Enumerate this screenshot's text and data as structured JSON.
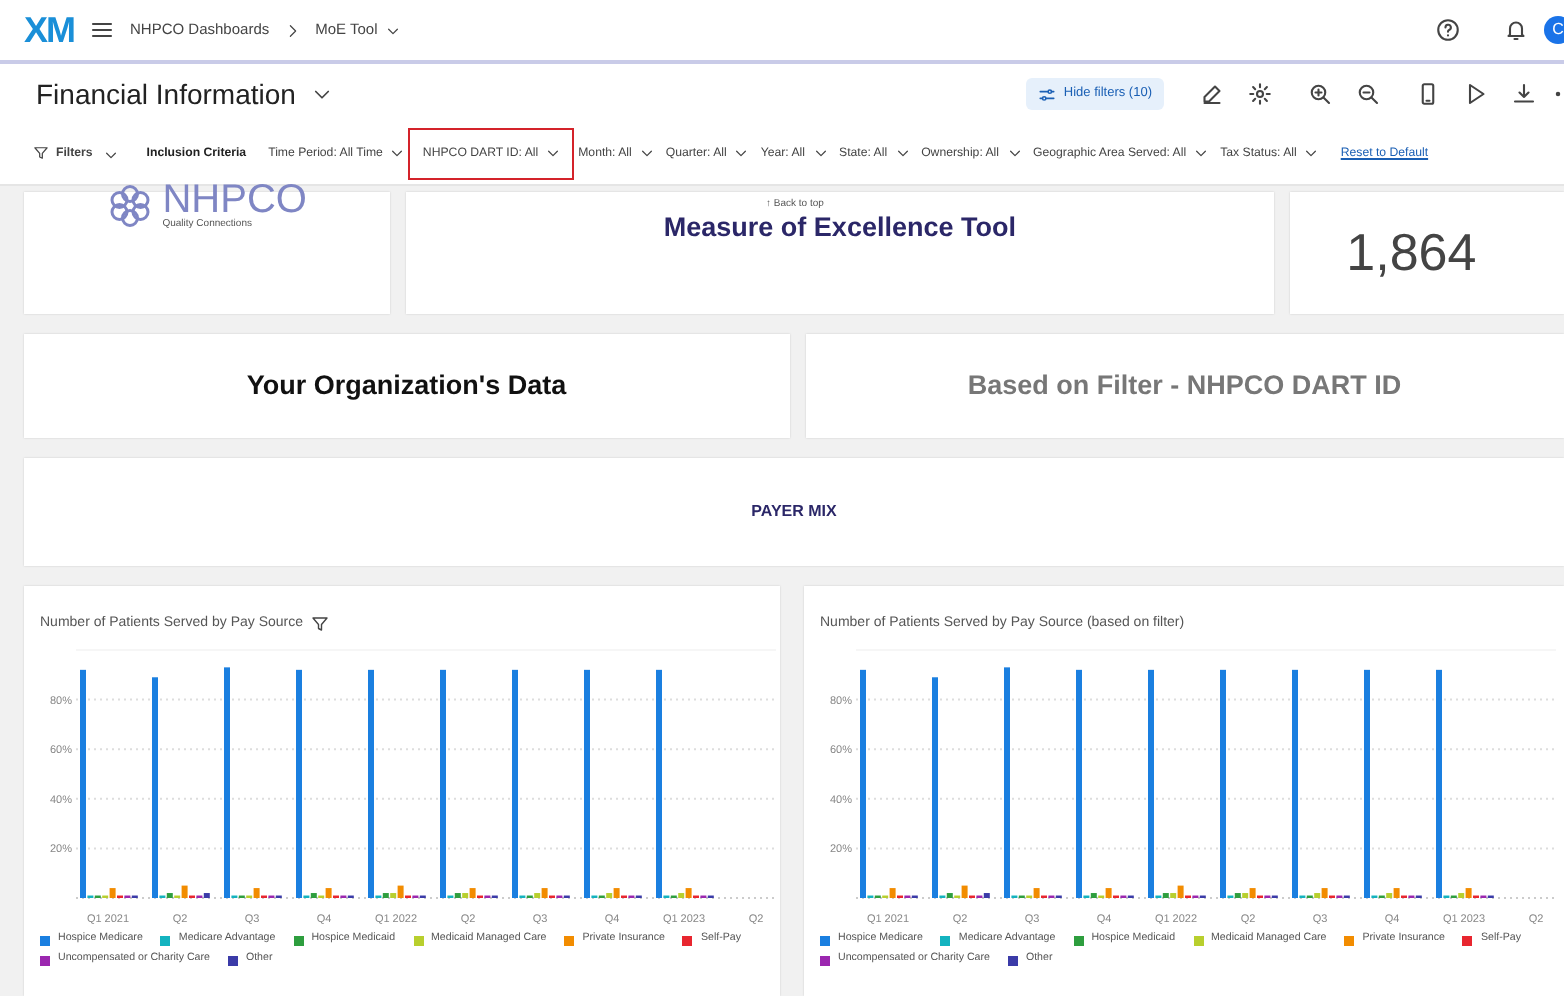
{
  "top_bar": {
    "logo": "XM",
    "breadcrumbs": [
      {
        "label": "NHPCO Dashboards",
        "dropdown": false
      },
      {
        "label": "MoE Tool",
        "dropdown": true
      }
    ],
    "avatar": "C"
  },
  "title_bar": {
    "title": "Financial Information",
    "hide_filters_button": "Hide filters (10)"
  },
  "filters": {
    "label": "Filters",
    "inclusion_label": "Inclusion Criteria",
    "items": [
      {
        "label": "Time Period: All Time",
        "highlighted": false
      },
      {
        "label": "NHPCO DART ID: All",
        "highlighted": true
      },
      {
        "label": "Month: All",
        "highlighted": false
      },
      {
        "label": "Quarter: All",
        "highlighted": false
      },
      {
        "label": "Year: All",
        "highlighted": false
      },
      {
        "label": "State: All",
        "highlighted": false
      },
      {
        "label": "Ownership: All",
        "highlighted": false
      },
      {
        "label": "Geographic Area Served: All",
        "highlighted": false
      },
      {
        "label": "Tax Status: All",
        "highlighted": false
      }
    ],
    "reset_link": "Reset to Default"
  },
  "back_to_top": "↑ Back to top",
  "header_cards": {
    "logo_name": "NHPCO",
    "logo_tagline": "Quality Connections",
    "tool_title": "Measure of Excellence Tool",
    "count": "1,864"
  },
  "section_cards": [
    {
      "title": "Your Organization's Data",
      "muted": false
    },
    {
      "title": "Based on Filter - NHPCO DART ID",
      "muted": true
    }
  ],
  "payer_mix": "PAYER MIX",
  "charts": [
    {
      "title": "Number of Patients Served by Pay Source",
      "filter_icon": true,
      "chart_data": {
        "type": "bar",
        "grid": true,
        "categories": [
          "Q1 2021",
          "Q2",
          "Q3",
          "Q4",
          "Q1 2022",
          "Q2",
          "Q3",
          "Q4",
          "Q1 2023",
          "Q2"
        ],
        "ylim": [
          0,
          100
        ],
        "yticks": [
          {
            "value": 20,
            "label": "20%"
          },
          {
            "value": 40,
            "label": "40%"
          },
          {
            "value": 60,
            "label": "60%"
          },
          {
            "value": 80,
            "label": "80%"
          }
        ],
        "series": [
          {
            "name": "Hospice Medicare",
            "color": "#1a7fe0",
            "values": [
              92,
              89,
              93,
              92,
              92,
              92,
              92,
              92,
              92,
              null
            ]
          },
          {
            "name": "Medicare Advantage",
            "color": "#14b3bf",
            "values": [
              1,
              1,
              1,
              1,
              1,
              1,
              1,
              1,
              1,
              null
            ]
          },
          {
            "name": "Hospice Medicaid",
            "color": "#2e9e3e",
            "values": [
              1,
              2,
              1,
              2,
              2,
              2,
              1,
              1,
              1,
              null
            ]
          },
          {
            "name": "Medicaid Managed Care",
            "color": "#b8cf2e",
            "values": [
              1,
              1,
              1,
              1,
              2,
              2,
              2,
              2,
              2,
              null
            ]
          },
          {
            "name": "Private Insurance",
            "color": "#f28c00",
            "values": [
              4,
              5,
              4,
              4,
              5,
              4,
              4,
              4,
              4,
              null
            ]
          },
          {
            "name": "Self-Pay",
            "color": "#e8262f",
            "values": [
              1,
              1,
              1,
              1,
              1,
              1,
              1,
              1,
              1,
              null
            ]
          },
          {
            "name": "Uncompensated or Charity Care",
            "color": "#9b27af",
            "values": [
              1,
              1,
              1,
              1,
              1,
              1,
              1,
              1,
              1,
              null
            ]
          },
          {
            "name": "Other",
            "color": "#3b3ba8",
            "values": [
              1,
              2,
              1,
              1,
              1,
              1,
              1,
              1,
              1,
              null
            ]
          }
        ]
      }
    },
    {
      "title": "Number of Patients Served by Pay Source (based on filter)",
      "filter_icon": false,
      "chart_data": {
        "type": "bar",
        "grid": true,
        "ylim": [
          0,
          100
        ],
        "categories": [
          "Q1 2021",
          "Q2",
          "Q3",
          "Q4",
          "Q1 2022",
          "Q2",
          "Q3",
          "Q4",
          "Q1 2023",
          "Q2"
        ],
        "yticks": [
          {
            "value": 20,
            "label": "20%"
          },
          {
            "value": 40,
            "label": "40%"
          },
          {
            "value": 60,
            "label": "60%"
          },
          {
            "value": 80,
            "label": "80%"
          }
        ],
        "series": [
          {
            "name": "Hospice Medicare",
            "color": "#1a7fe0",
            "values": [
              92,
              89,
              93,
              92,
              92,
              92,
              92,
              92,
              92,
              null
            ]
          },
          {
            "name": "Medicare Advantage",
            "color": "#14b3bf",
            "values": [
              1,
              1,
              1,
              1,
              1,
              1,
              1,
              1,
              1,
              null
            ]
          },
          {
            "name": "Hospice Medicaid",
            "color": "#2e9e3e",
            "values": [
              1,
              2,
              1,
              2,
              2,
              2,
              1,
              1,
              1,
              null
            ]
          },
          {
            "name": "Medicaid Managed Care",
            "color": "#b8cf2e",
            "values": [
              1,
              1,
              1,
              1,
              2,
              2,
              2,
              2,
              2,
              null
            ]
          },
          {
            "name": "Private Insurance",
            "color": "#f28c00",
            "values": [
              4,
              5,
              4,
              4,
              5,
              4,
              4,
              4,
              4,
              null
            ]
          },
          {
            "name": "Self-Pay",
            "color": "#e8262f",
            "values": [
              1,
              1,
              1,
              1,
              1,
              1,
              1,
              1,
              1,
              null
            ]
          },
          {
            "name": "Uncompensated or Charity Care",
            "color": "#9b27af",
            "values": [
              1,
              1,
              1,
              1,
              1,
              1,
              1,
              1,
              1,
              null
            ]
          },
          {
            "name": "Other",
            "color": "#3b3ba8",
            "values": [
              1,
              2,
              1,
              1,
              1,
              1,
              1,
              1,
              1,
              null
            ]
          }
        ]
      }
    }
  ]
}
